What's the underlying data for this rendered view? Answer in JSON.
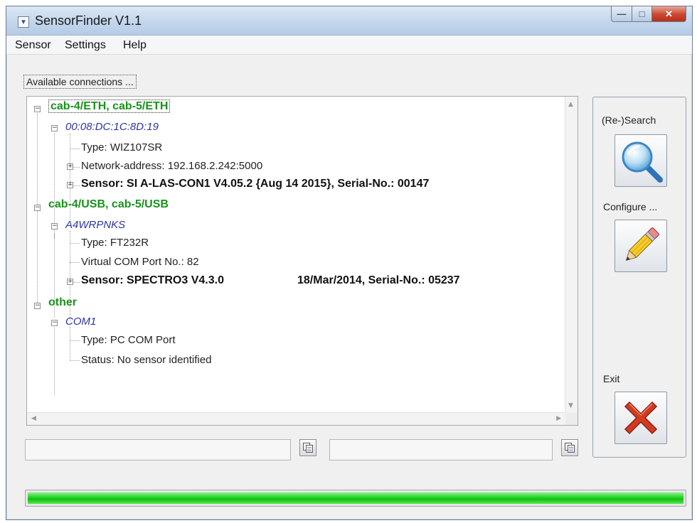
{
  "window": {
    "title": "SensorFinder V1.1"
  },
  "menu": {
    "items": [
      "Sensor",
      "Settings",
      "Help"
    ]
  },
  "connections": {
    "label": "Available connections ...",
    "eth": {
      "group": "cab-4/ETH, cab-5/ETH",
      "device": "00:08:DC:1C:8D:19",
      "type": "Type: WIZ107SR",
      "network": "Network-address: 192.168.2.242:5000",
      "sensor": "Sensor: SI A-LAS-CON1 V4.05.2 {Aug 14 2015}, Serial-No.: 00147"
    },
    "usb": {
      "group": "cab-4/USB, cab-5/USB",
      "device": "A4WRPNKS",
      "type": "Type: FT232R",
      "port": "Virtual COM Port No.: 82",
      "sensor_name": "Sensor: SPECTRO3 V4.3.0",
      "sensor_info": "18/Mar/2014, Serial-No.: 05237"
    },
    "other": {
      "group": "other",
      "device": "COM1",
      "type": "Type: PC COM Port",
      "status": "Status: No sensor identified"
    }
  },
  "buttons": {
    "search": "(Re-)Search",
    "configure": "Configure ...",
    "exit": "Exit"
  },
  "icons": {
    "search": "magnifier-icon",
    "configure": "pencil-icon",
    "exit": "red-x-icon",
    "app": "app-icon",
    "copy": "copy-icon"
  },
  "status": {
    "field1": "",
    "field2": ""
  },
  "progress": {
    "value": 1.0
  },
  "colors": {
    "group": "#19921d",
    "device": "#2f34a8",
    "progress": "#1fd31f",
    "exit": "#d23b22"
  }
}
